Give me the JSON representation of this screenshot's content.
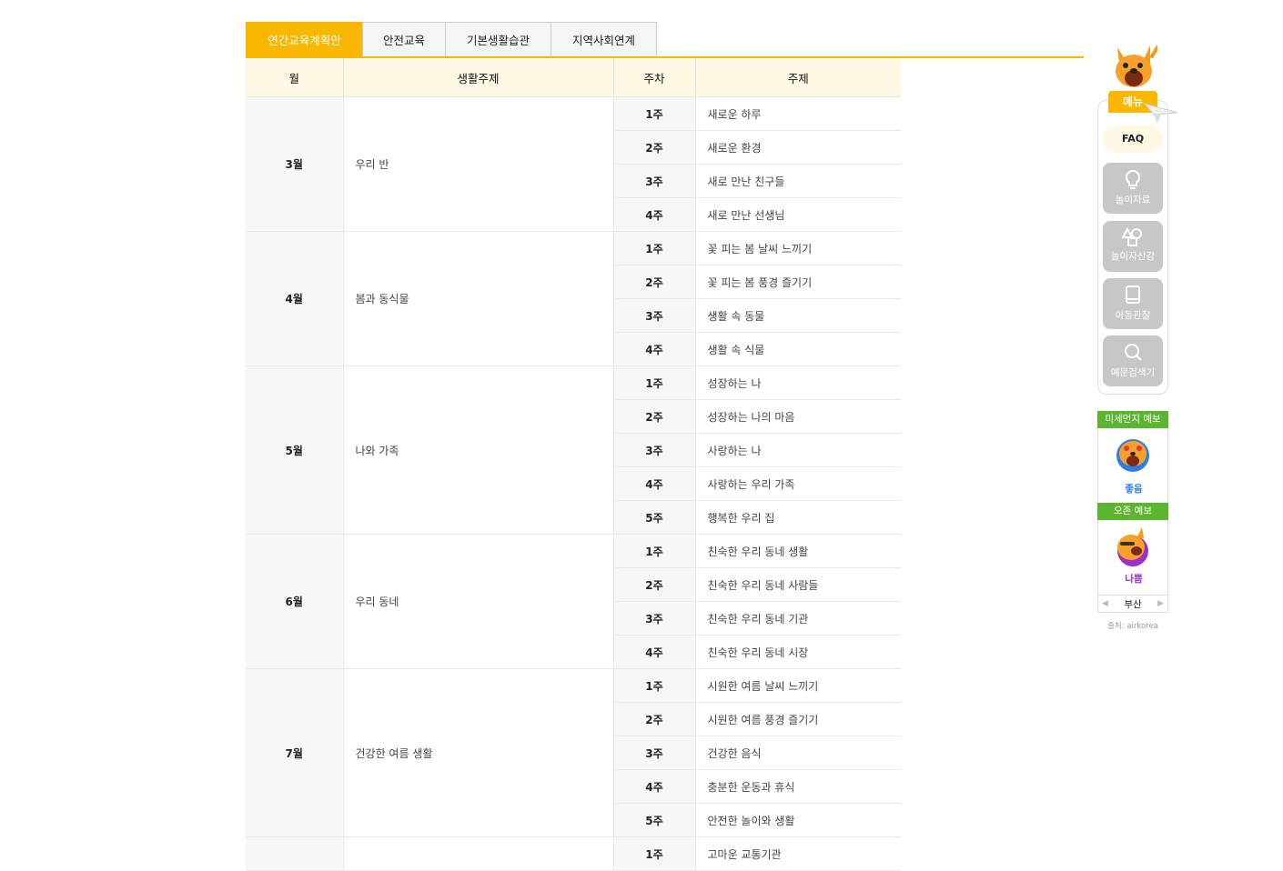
{
  "tabs": [
    "연간교육계획안",
    "안전교육",
    "기본생활습관",
    "지역사회연계"
  ],
  "table": {
    "headers": [
      "월",
      "생활주제",
      "주차",
      "주제"
    ],
    "rows": [
      {
        "month": "3월",
        "theme": "우리 반",
        "weeks": [
          {
            "week": "1주",
            "topic": "새로운 하루"
          },
          {
            "week": "2주",
            "topic": "새로운 환경"
          },
          {
            "week": "3주",
            "topic": "새로 만난 친구들"
          },
          {
            "week": "4주",
            "topic": "새로 만난 선생님"
          }
        ]
      },
      {
        "month": "4월",
        "theme": "봄과 동식물",
        "weeks": [
          {
            "week": "1주",
            "topic": "꽃 피는 봄 날씨 느끼기"
          },
          {
            "week": "2주",
            "topic": "꽃 피는 봄 풍경 즐기기"
          },
          {
            "week": "3주",
            "topic": "생활 속 동물"
          },
          {
            "week": "4주",
            "topic": "생활 속 식물"
          }
        ]
      },
      {
        "month": "5월",
        "theme": "나와 가족",
        "weeks": [
          {
            "week": "1주",
            "topic": "성장하는 나"
          },
          {
            "week": "2주",
            "topic": "성장하는 나의 마음"
          },
          {
            "week": "3주",
            "topic": "사랑하는 나"
          },
          {
            "week": "4주",
            "topic": "사랑하는 우리 가족"
          },
          {
            "week": "5주",
            "topic": "행복한 우리 집"
          }
        ]
      },
      {
        "month": "6월",
        "theme": "우리 동네",
        "weeks": [
          {
            "week": "1주",
            "topic": "친숙한 우리 동네 생활"
          },
          {
            "week": "2주",
            "topic": "친숙한 우리 동네 사람들"
          },
          {
            "week": "3주",
            "topic": "친숙한 우리 동네 기관"
          },
          {
            "week": "4주",
            "topic": "친숙한 우리 동네 시장"
          }
        ]
      },
      {
        "month": "7월",
        "theme": "건강한 여름 생활",
        "weeks": [
          {
            "week": "1주",
            "topic": "시원한 여름 날씨 느끼기"
          },
          {
            "week": "2주",
            "topic": "시원한 여름 풍경 즐기기"
          },
          {
            "week": "3주",
            "topic": "건강한 음식"
          },
          {
            "week": "4주",
            "topic": "충분한 운동과 휴식"
          },
          {
            "week": "5주",
            "topic": "안전한 놀이와 생활"
          }
        ]
      },
      {
        "month": "",
        "theme": "",
        "weeks": [
          {
            "week": "1주",
            "topic": "고마운 교통기관"
          }
        ]
      }
    ]
  },
  "sidebar": {
    "menu_label": "메뉴",
    "faq_label": "FAQ",
    "buttons": [
      {
        "label": "놀이자료",
        "icon": "lightbulb-icon"
      },
      {
        "label": "놀이자산감",
        "icon": "shapes-icon"
      },
      {
        "label": "아동관찰",
        "icon": "book-icon"
      },
      {
        "label": "예문검색기",
        "icon": "search-icon"
      }
    ],
    "dust_title": "미세먼지 예보",
    "dust_status": "좋음",
    "ozone_title": "오존 예보",
    "ozone_status": "나쁨",
    "region": "부산",
    "source": "출처: airkorea",
    "colors": {
      "accent": "#f9b700",
      "green": "#5cb531",
      "good": "#2b7de9",
      "bad": "#9b2fc7"
    }
  }
}
